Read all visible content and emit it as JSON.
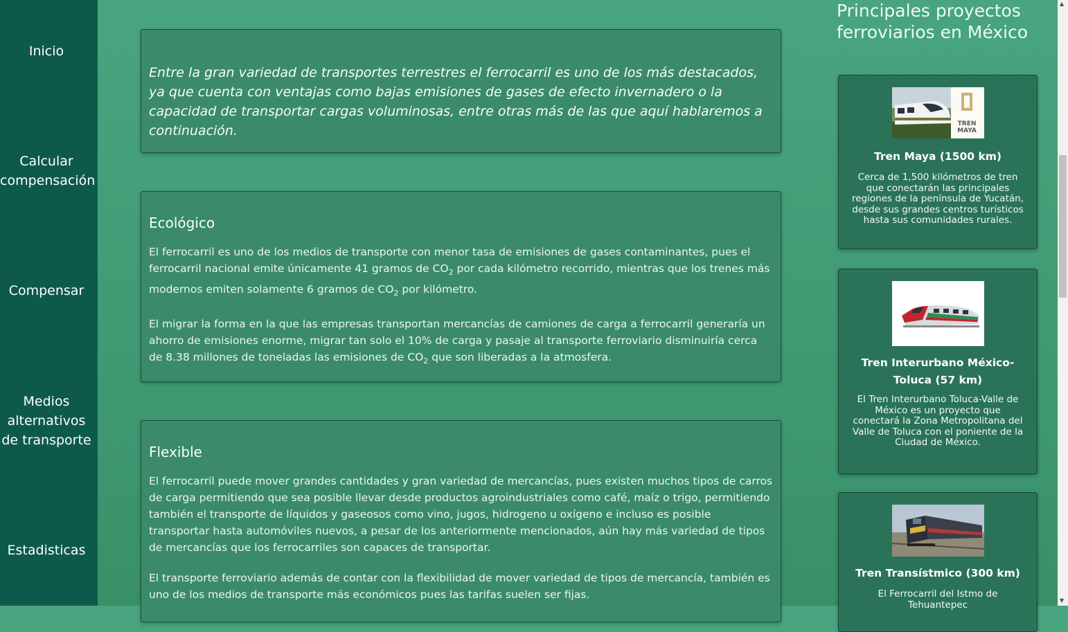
{
  "sidebar": {
    "items": [
      {
        "label": "Inicio"
      },
      {
        "label": "Calcular compensación"
      },
      {
        "label": "Compensar"
      },
      {
        "label": "Medios alternativos de transporte"
      },
      {
        "label": "Estadisticas"
      }
    ]
  },
  "intro": {
    "text": "Entre la gran variedad de transportes terrestres el ferrocarril es uno de los más destacados, ya que cuenta con ventajas como bajas emisiones de gases de efecto invernadero o la capacidad de transportar cargas voluminosas, entre otras más de las que aquí hablaremos a continuación."
  },
  "sections": [
    {
      "heading": "Ecológico",
      "p1_a": "El ferrocarril es uno de los medios de transporte con menor tasa de emisiones de gases contaminantes, pues el ferrocarril nacional emite únicamente 41 gramos de CO",
      "p1_sub1": "2",
      "p1_b": " por cada kilómetro recorrido, mientras que los trenes más modernos emiten solamente 6 gramos de CO",
      "p1_sub2": "2",
      "p1_c": " por kilómetro.",
      "p2_a": "El migrar la forma en la que las empresas transportan mercancías de camiones de carga a ferrocarril generaría un ahorro de emisiones enorme, migrar tan solo el 10% de carga y pasaje al transporte ferroviario disminuiría cerca de 8.38 millones de toneladas las emisiones de CO",
      "p2_sub": "2",
      "p2_b": " que son liberadas a la atmosfera."
    },
    {
      "heading": "Flexible",
      "p1": "El ferrocarril puede mover grandes cantidades y gran variedad de mercancías, pues existen muchos tipos de carros de carga permitiendo que sea posible llevar desde productos agroindustriales como café, maíz o trigo, permitiendo también el transporte de líquidos y gaseosos como vino, jugos, hidrogeno u oxígeno e incluso es posible transportar hasta automóviles nuevos, a pesar de los anteriormente mencionados, aún hay más variedad de tipos de mercancías que los ferrocarriles son capaces de transportar.",
      "p2": "El transporte ferroviario además de contar con la flexibilidad de mover variedad de tipos de mercancía, también es uno de los medios de transporte más económicos pues las tarifas suelen ser fijas."
    }
  ],
  "projects": {
    "title": "Principales proyectos ferroviarios en México",
    "items": [
      {
        "name": "Tren Maya (1500 km)",
        "logo_text": "TREN MAYA",
        "desc": "Cerca de 1,500 kilómetros de tren que conectarán las principales regiones de la península de Yucatán, desde sus grandes centros turísticos hasta sus comunidades rurales."
      },
      {
        "name": "Tren Interurbano México-Toluca (57 km)",
        "desc": "El Tren Interurbano Toluca-Valle de México es un proyecto que conectará la Zona Metropolitana del Valle de Toluca con el poniente de la Ciudad de México."
      },
      {
        "name": "Tren Transístmico (300 km)",
        "desc": "El Ferrocarril del Istmo de Tehuantepec"
      }
    ]
  },
  "colors": {
    "sidebar": "#0e5a4a",
    "background": "#45a17b",
    "card": "#3b8a6c",
    "project_card": "#2b7358"
  }
}
